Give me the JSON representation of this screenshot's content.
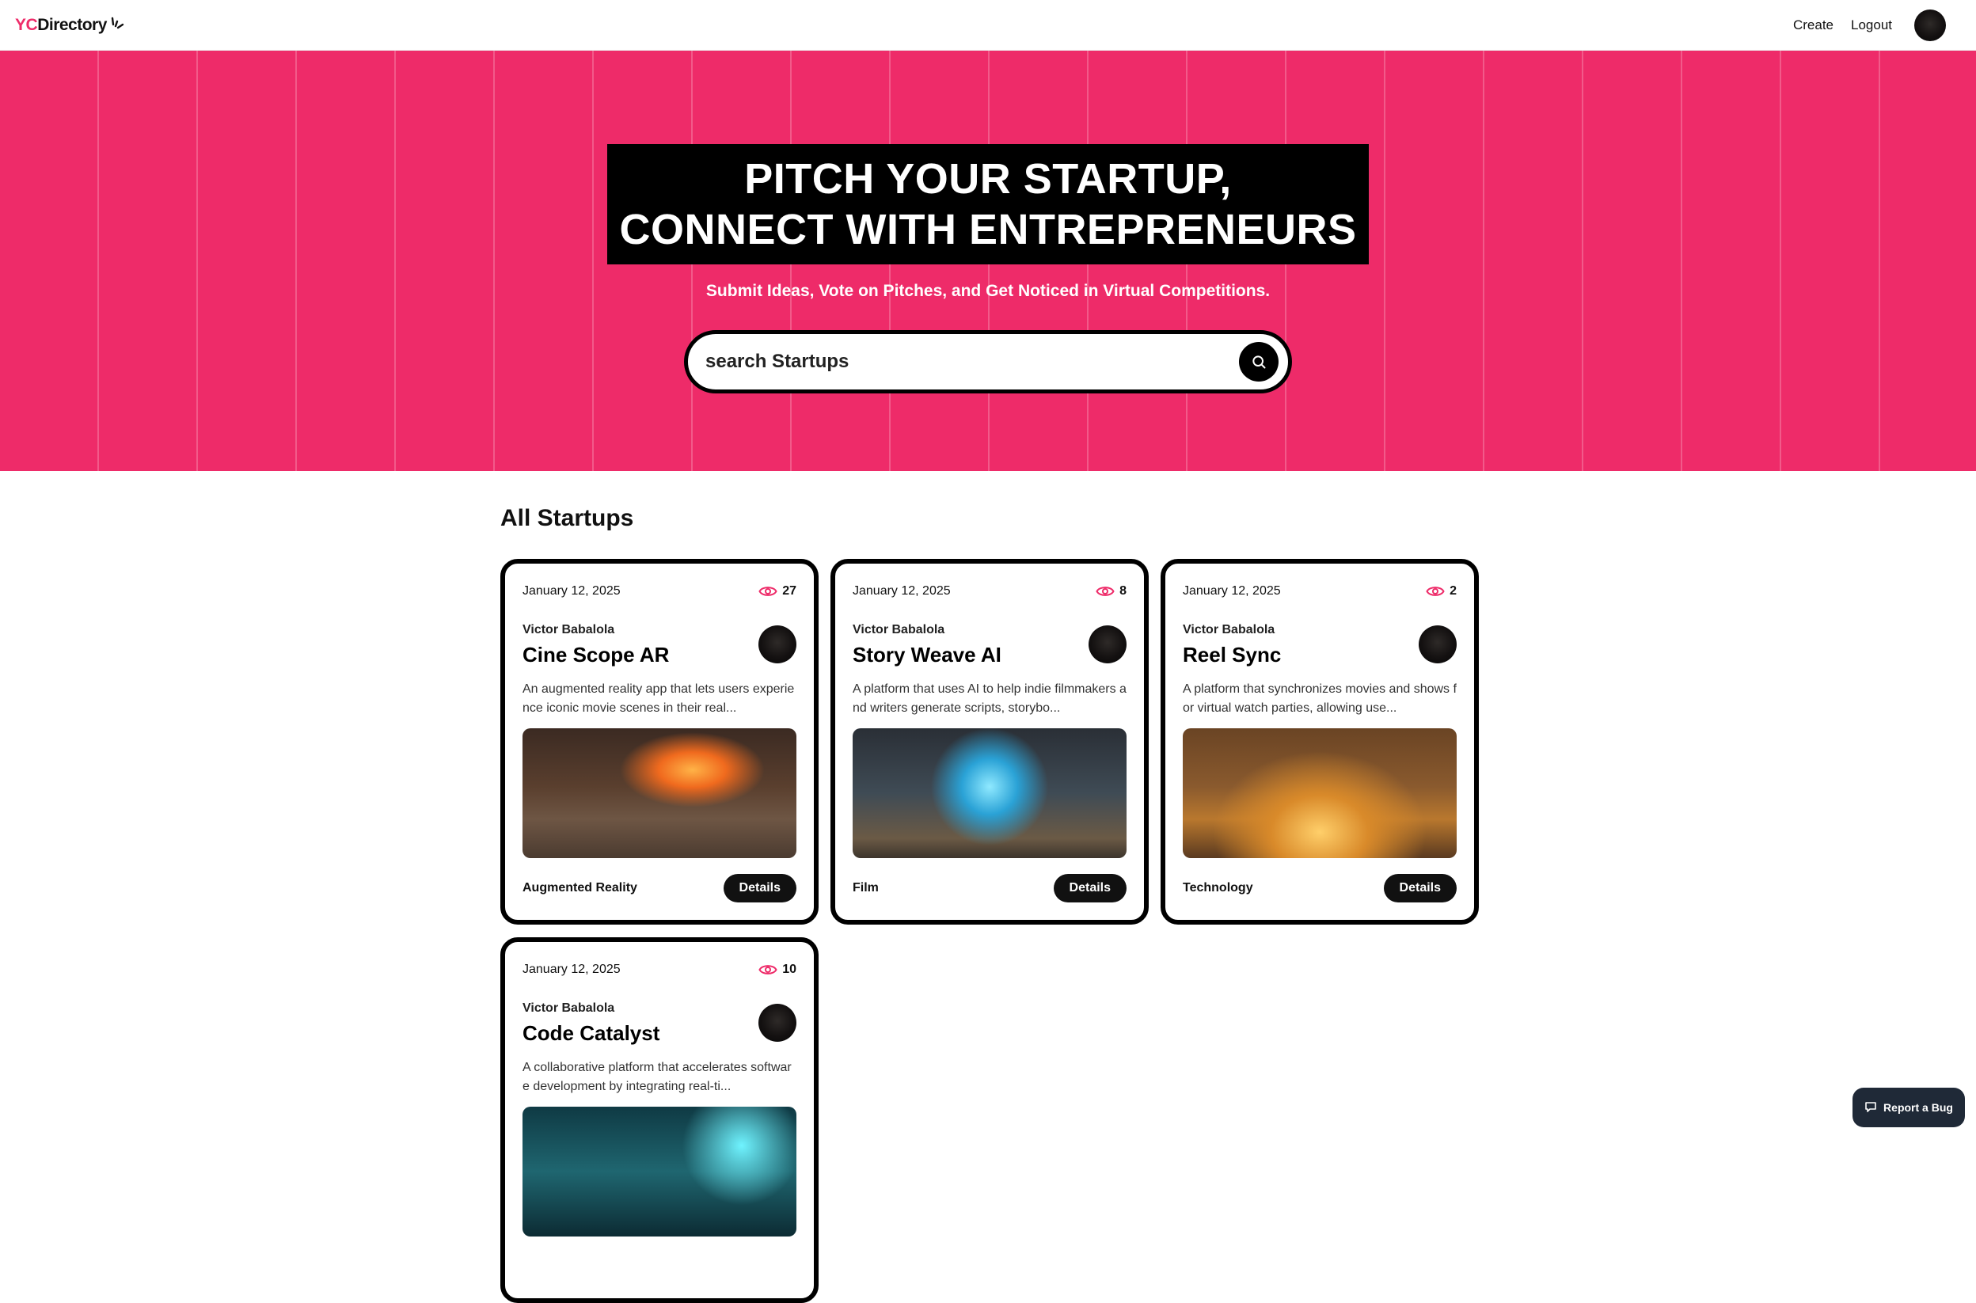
{
  "navbar": {
    "logo_yc": "YC",
    "logo_rest": "Directory",
    "create_label": "Create",
    "logout_label": "Logout"
  },
  "hero": {
    "heading_line1": "Pitch Your Startup,",
    "heading_line2": "Connect With Entrepreneurs",
    "subheading": "Submit Ideas, Vote on Pitches, and Get Noticed in Virtual Competitions.",
    "search_placeholder": "search Startups"
  },
  "section": {
    "title": "All Startups"
  },
  "startups": [
    {
      "date": "January 12, 2025",
      "views": "27",
      "author": "Victor Babalola",
      "title": "Cine Scope AR",
      "description": "An augmented reality app that lets users experience iconic movie scenes in their real...",
      "category": "Augmented Reality",
      "details_label": "Details"
    },
    {
      "date": "January 12, 2025",
      "views": "8",
      "author": "Victor Babalola",
      "title": "Story Weave AI",
      "description": "A platform that uses AI to help indie filmmakers and writers generate scripts, storybo...",
      "category": "Film",
      "details_label": "Details"
    },
    {
      "date": "January 12, 2025",
      "views": "2",
      "author": "Victor Babalola",
      "title": "Reel Sync",
      "description": "A platform that synchronizes movies and shows for virtual watch parties, allowing use...",
      "category": "Technology",
      "details_label": "Details"
    },
    {
      "date": "January 12, 2025",
      "views": "10",
      "author": "Victor Babalola",
      "title": "Code Catalyst",
      "description": "A collaborative platform that accelerates software development by integrating real-ti...",
      "category": "",
      "details_label": ""
    }
  ],
  "report_bug": {
    "label": "Report a Bug"
  },
  "colors": {
    "primary": "#EE2B69",
    "dark": "#000000",
    "pill": "#111111"
  },
  "icons": [
    "logo-spark-icon",
    "search-icon",
    "eye-icon",
    "bug-report-icon"
  ]
}
